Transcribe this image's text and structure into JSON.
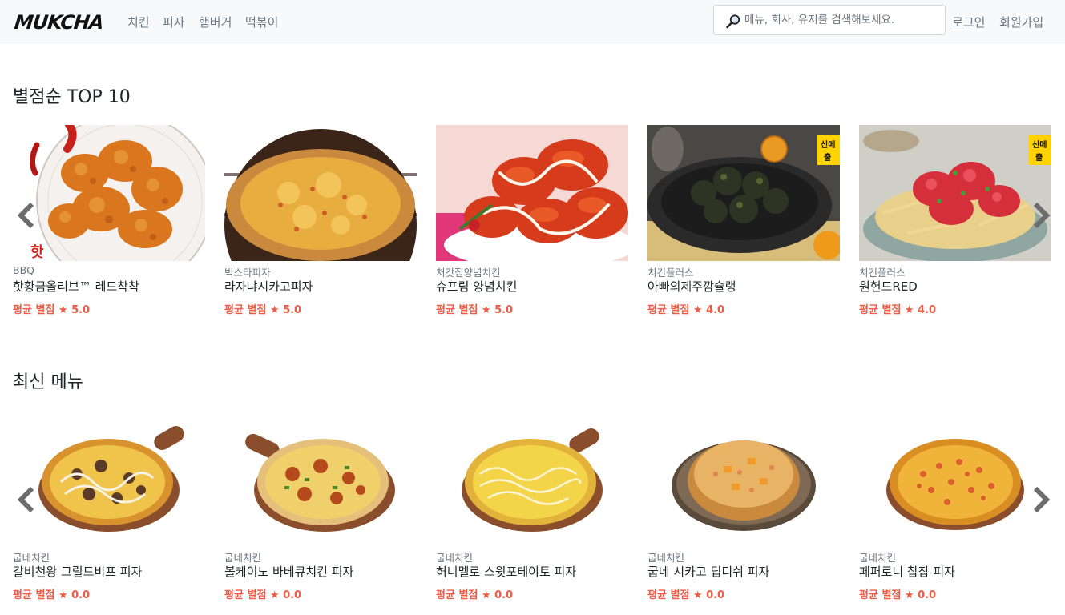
{
  "header": {
    "logo": "MUKCHA",
    "nav": [
      "치킨",
      "피자",
      "햄버거",
      "떡볶이"
    ],
    "search_placeholder": "메뉴, 회사, 유저를 검색해보세요.",
    "login": "로그인",
    "signup": "회원가입"
  },
  "sections": [
    {
      "title": "별점순 TOP 10",
      "items": [
        {
          "brand": "BBQ",
          "name": "핫황금올리브™ 레드착착",
          "rating": "평균 별점 ★ 5.0"
        },
        {
          "brand": "빅스타피자",
          "name": "라자냐시카고피자",
          "rating": "평균 별점 ★ 5.0"
        },
        {
          "brand": "처갓집양념치킨",
          "name": "슈프림 양념치킨",
          "rating": "평균 별점 ★ 5.0"
        },
        {
          "brand": "치킨플러스",
          "name": "아빠의제주깜슐랭",
          "rating": "평균 별점 ★ 4.0"
        },
        {
          "brand": "치킨플러스",
          "name": "원헌드RED",
          "rating": "평균 별점 ★ 4.0"
        }
      ]
    },
    {
      "title": "최신 메뉴",
      "items": [
        {
          "brand": "굽네치킨",
          "name": "갈비천왕 그릴드비프 피자",
          "rating": "평균 별점 ★ 0.0"
        },
        {
          "brand": "굽네치킨",
          "name": "볼케이노 바베큐치킨 피자",
          "rating": "평균 별점 ★ 0.0"
        },
        {
          "brand": "굽네치킨",
          "name": "허니멜로 스윗포테이토 피자",
          "rating": "평균 별점 ★ 0.0"
        },
        {
          "brand": "굽네치킨",
          "name": "굽네 시카고 딥디쉬 피자",
          "rating": "평균 별점 ★ 0.0"
        },
        {
          "brand": "굽네치킨",
          "name": "페퍼로니 찹찹 피자",
          "rating": "평균 별점 ★ 0.0"
        }
      ]
    }
  ],
  "colors": {
    "rating": "#ef5b45",
    "navbar_bg": "#f8f9fa",
    "arrow": "#6c6c6c"
  },
  "icons": [
    "search-icon",
    "chevron-left-icon",
    "chevron-right-icon"
  ]
}
